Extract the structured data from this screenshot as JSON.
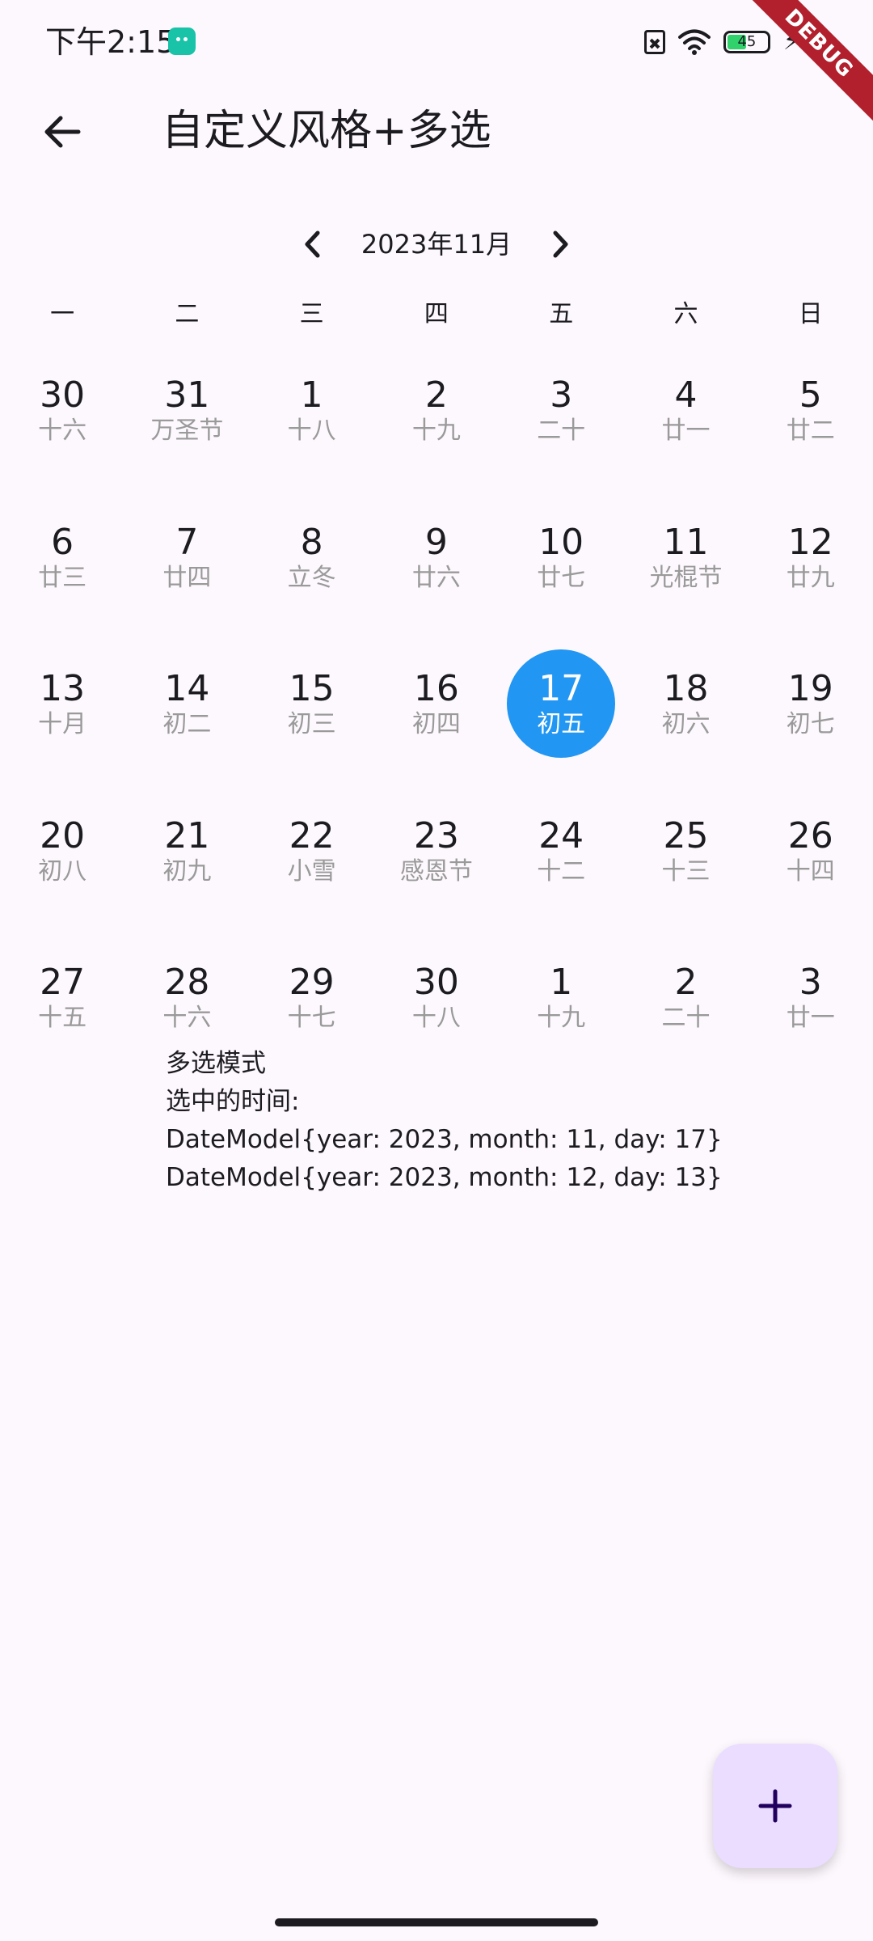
{
  "status_bar": {
    "time": "下午2:15",
    "app_icon": "app-notification-icon",
    "battery_level": "45",
    "icons": [
      "sim-off-icon",
      "wifi-icon",
      "battery-icon",
      "charging-icon"
    ]
  },
  "debug_banner": {
    "label": "DEBUG",
    "color": "#b21f2d"
  },
  "app_bar": {
    "back_icon": "arrow-back-icon",
    "title": "自定义风格+多选"
  },
  "calendar": {
    "month_label": "2023年11月",
    "prev_icon": "chevron-left-icon",
    "next_icon": "chevron-right-icon",
    "weekdays": [
      "一",
      "二",
      "三",
      "四",
      "五",
      "六",
      "日"
    ],
    "selected_color": "#2196f3",
    "weeks": [
      [
        {
          "day": "30",
          "lunar": "十六"
        },
        {
          "day": "31",
          "lunar": "万圣节"
        },
        {
          "day": "1",
          "lunar": "十八"
        },
        {
          "day": "2",
          "lunar": "十九"
        },
        {
          "day": "3",
          "lunar": "二十"
        },
        {
          "day": "4",
          "lunar": "廿一"
        },
        {
          "day": "5",
          "lunar": "廿二"
        }
      ],
      [
        {
          "day": "6",
          "lunar": "廿三"
        },
        {
          "day": "7",
          "lunar": "廿四"
        },
        {
          "day": "8",
          "lunar": "立冬"
        },
        {
          "day": "9",
          "lunar": "廿六"
        },
        {
          "day": "10",
          "lunar": "廿七"
        },
        {
          "day": "11",
          "lunar": "光棍节"
        },
        {
          "day": "12",
          "lunar": "廿九"
        }
      ],
      [
        {
          "day": "13",
          "lunar": "十月"
        },
        {
          "day": "14",
          "lunar": "初二"
        },
        {
          "day": "15",
          "lunar": "初三"
        },
        {
          "day": "16",
          "lunar": "初四"
        },
        {
          "day": "17",
          "lunar": "初五",
          "selected": true
        },
        {
          "day": "18",
          "lunar": "初六"
        },
        {
          "day": "19",
          "lunar": "初七"
        }
      ],
      [
        {
          "day": "20",
          "lunar": "初八"
        },
        {
          "day": "21",
          "lunar": "初九"
        },
        {
          "day": "22",
          "lunar": "小雪"
        },
        {
          "day": "23",
          "lunar": "感恩节"
        },
        {
          "day": "24",
          "lunar": "十二"
        },
        {
          "day": "25",
          "lunar": "十三"
        },
        {
          "day": "26",
          "lunar": "十四"
        }
      ],
      [
        {
          "day": "27",
          "lunar": "十五"
        },
        {
          "day": "28",
          "lunar": "十六"
        },
        {
          "day": "29",
          "lunar": "十七"
        },
        {
          "day": "30",
          "lunar": "十八"
        },
        {
          "day": "1",
          "lunar": "十九"
        },
        {
          "day": "2",
          "lunar": "二十"
        },
        {
          "day": "3",
          "lunar": "廿一"
        }
      ]
    ]
  },
  "info": {
    "mode": "多选模式",
    "selected_label": "选中的时间:",
    "dates": [
      "DateModel{year: 2023, month: 11, day: 17}",
      "DateModel{year: 2023, month: 12, day: 13}"
    ]
  },
  "fab": {
    "icon": "plus-icon",
    "color": "#eaddff"
  }
}
